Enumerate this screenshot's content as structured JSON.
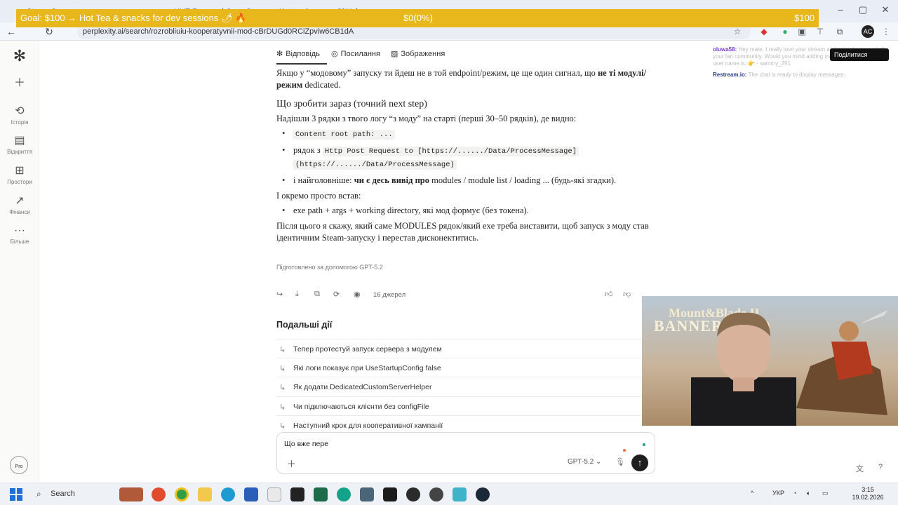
{
  "browser": {
    "tabs": [
      "Steam Support",
      "HUE Resorted Crew Steam",
      "Hot tea issue — GitHub",
      "Chat"
    ],
    "url": "perplexity.ai/search/rozrobliuiu-kooperatyvnii-mod-cBrDUGd0RCiZpviw6CB1dA"
  },
  "goal": {
    "left": "Goal: $100 → Hot Tea & snacks for dev sessions 🌶 🔥",
    "center": "$0(0%)",
    "right": "$100",
    "progress": 0
  },
  "sidebar": {
    "items": [
      {
        "icon": "plus-icon",
        "label": ""
      },
      {
        "icon": "history-icon",
        "label": "Історія"
      },
      {
        "icon": "discover-icon",
        "label": "Відкриття"
      },
      {
        "icon": "spaces-icon",
        "label": "Простори"
      },
      {
        "icon": "finance-icon",
        "label": "Фінанси"
      },
      {
        "icon": "more-icon",
        "label": "Більше"
      }
    ],
    "pro_label": "Pro"
  },
  "tabs": {
    "answer": "Відповідь",
    "sources": "Посилання",
    "images": "Зображення"
  },
  "answer": {
    "p1_a": "Якщо у “модовому” запуску ти йдеш не в той endpoint/режим, це ще один сигнал, що ",
    "p1_b": "не ті модулі/режим",
    "p1_c": " dedicated.",
    "h_next": "Що зробити зараз (точний next step)",
    "p2": "Надішли 3 рядки з твого логу “з моду” на старті (перші 30–50 рядків), де видно:",
    "b1": "Content root path: ...",
    "b2_a": "рядок з ",
    "b2_code1": "Http Post Request to [https://....../Data/ProcessMessage]",
    "b2_code2": "(https://....../Data/ProcessMessage)",
    "b3_a": "і найголовніше: ",
    "b3_b": "чи є десь вивід про",
    "b3_c": " modules / module list / loading ... (будь-які згадки).",
    "p3": "І окремо просто встав:",
    "b4": "exe path + args + working directory, які мод формує (без токена).",
    "p4": "Після цього я скажу, який саме MODULES рядок/який exe треба виставити, щоб запуск з моду став ідентичним Steam-запуску і перестав дисконектитись.",
    "prepared": "Підготовлено за допомогою GPT-5.2"
  },
  "actions": {
    "sources_count": "16 джерел"
  },
  "followups": {
    "title": "Подальші дії",
    "items": [
      "Тепер протестуй запуск сервера з модулем",
      "Які логи показує при UseStartupConfig false",
      "Як додати DedicatedCustomServerHelper",
      "Чи підключаються клієнти без configFile",
      "Наступний крок для кооперативної кампанії"
    ]
  },
  "input": {
    "value": "Що вже пере",
    "model": "GPT-5.2"
  },
  "chat": {
    "messages": [
      {
        "user": "oluwa58:",
        "text": "Hey mate, I really love your stream and enjoy being part of your fan community. Would you mind adding me up on discord? my user name is: 👉 · sammy_291"
      },
      {
        "user": "Restream.io:",
        "text": "The chat is ready to display messages."
      }
    ],
    "share_label": "Поділитися"
  },
  "webcam": {
    "title1": "Mount&Blade II",
    "title2": "BANNERLORD"
  },
  "taskbar": {
    "search": "Search",
    "lang": "УКР",
    "time": "3:15",
    "date": "19.02.2026"
  }
}
